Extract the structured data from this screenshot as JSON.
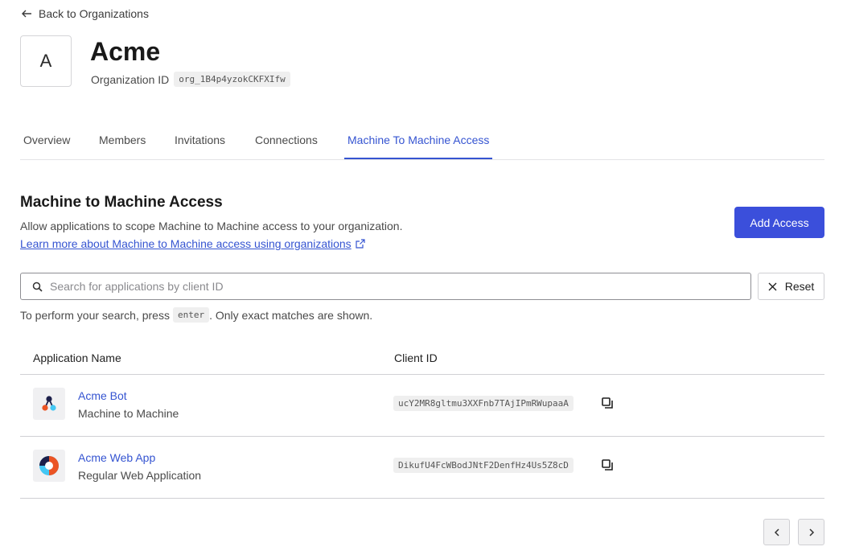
{
  "nav": {
    "back_label": "Back to Organizations"
  },
  "org": {
    "initial": "A",
    "name": "Acme",
    "id_label": "Organization ID",
    "id_value": "org_1B4p4yzokCKFXIfw"
  },
  "tabs": [
    {
      "label": "Overview",
      "active": false
    },
    {
      "label": "Members",
      "active": false
    },
    {
      "label": "Invitations",
      "active": false
    },
    {
      "label": "Connections",
      "active": false
    },
    {
      "label": "Machine To Machine Access",
      "active": true
    }
  ],
  "section": {
    "title": "Machine to Machine Access",
    "description": "Allow applications to scope Machine to Machine access to your organization.",
    "link_label": "Learn more about Machine to Machine access using organizations",
    "add_button": "Add Access"
  },
  "search": {
    "placeholder": "Search for applications by client ID",
    "value": "",
    "reset_label": "Reset",
    "hint_before": "To perform your search, press",
    "hint_key": "enter",
    "hint_after": ". Only exact matches are shown."
  },
  "table": {
    "columns": [
      "Application Name",
      "Client ID"
    ],
    "rows": [
      {
        "name": "Acme Bot",
        "type": "Machine to Machine",
        "client_id": "ucY2MR8gltmu3XXFnb7TAjIPmRWupaaA",
        "icon": "machine-to-machine-app-icon"
      },
      {
        "name": "Acme Web App",
        "type": "Regular Web Application",
        "client_id": "DikufU4FcWBodJNtF2DenfHz4Us5Z8cD",
        "icon": "regular-web-app-icon"
      }
    ]
  },
  "colors": {
    "accent": "#3554d1",
    "primary_button": "#3b4fdb"
  }
}
